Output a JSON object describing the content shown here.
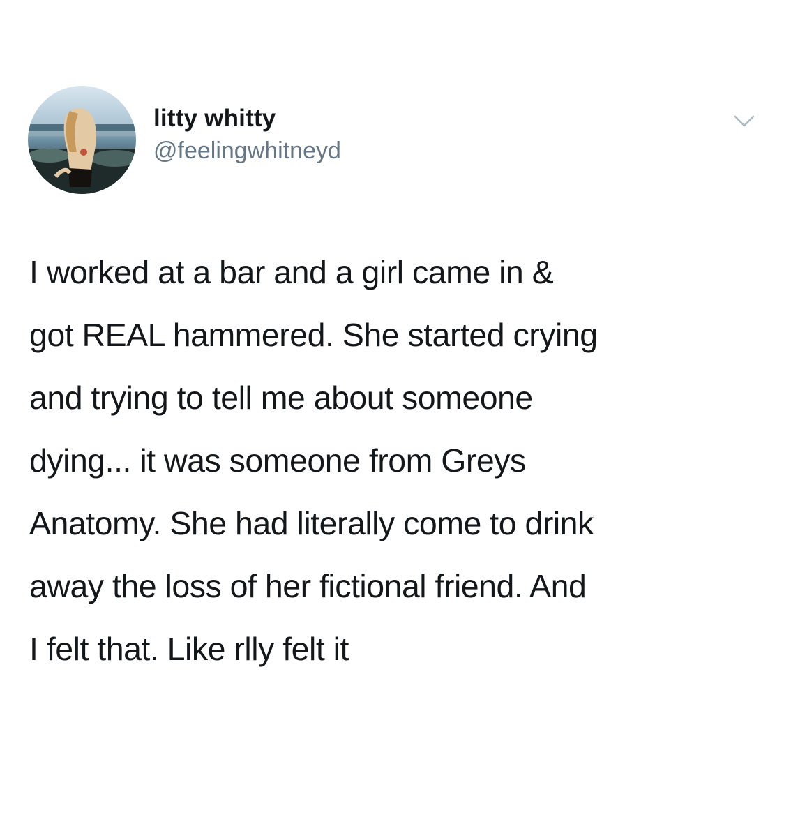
{
  "tweet": {
    "author": {
      "display_name": "litty whitty",
      "handle": "@feelingwhitneyd"
    },
    "menu_icon": "chevron-down-icon",
    "text_lines": [
      "I worked at a bar and a girl came in &",
      "got REAL hammered. She started crying",
      "and trying to tell me about someone",
      "dying... it was someone from Greys",
      "Anatomy. She had literally come to drink",
      "away the loss of her fictional friend. And",
      "I felt that. Like rlly felt it"
    ]
  },
  "colors": {
    "text": "#14171a",
    "secondary_text": "#657786",
    "background": "#ffffff",
    "caret": "#aab8c2"
  }
}
